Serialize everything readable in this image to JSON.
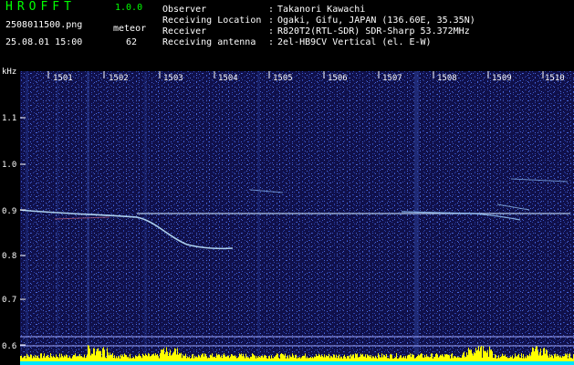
{
  "app": {
    "title": "HROFFT",
    "version": "1.0.0"
  },
  "meta": {
    "file_name": "2508011500.png",
    "date_time": "25.08.01 15:00",
    "mode_label": "meteor",
    "count": "62"
  },
  "info": [
    {
      "key": "Observer",
      "value": "Takanori Kawachi"
    },
    {
      "key": "Receiving Location",
      "value": "Ogaki, Gifu, JAPAN (136.60E, 35.35N)"
    },
    {
      "key": "Receiver",
      "value": "R820T2(RTL-SDR) SDR-Sharp 53.372MHz"
    },
    {
      "key": "Receiving antenna",
      "value": "2el-HB9CV Vertical (el. E-W)"
    }
  ],
  "separator": ":",
  "axis": {
    "unit": "kHz",
    "y_ticks": [
      "1.1",
      "1.0",
      "0.9",
      "0.8",
      "0.7",
      "0.6"
    ],
    "x_ticks": [
      "1501",
      "1502",
      "1503",
      "1504",
      "1505",
      "1506",
      "1507",
      "1508",
      "1509",
      "1510"
    ]
  },
  "colors": {
    "background": "#10104a",
    "noise": "#3a56c8",
    "signal": "#bfe6ff",
    "bars_yellow": "#ffff00",
    "bars_cyan": "#00e5ff"
  }
}
